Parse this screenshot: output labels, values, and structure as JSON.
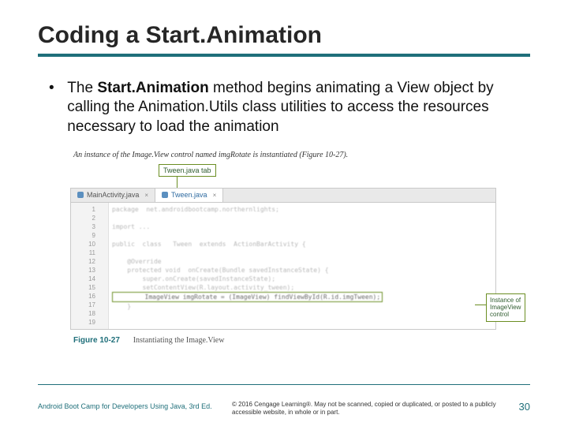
{
  "title": "Coding a Start.Animation",
  "bullet": {
    "prefix": "The ",
    "strong": "Start.Animation",
    "rest": " method begins animating a View object by calling the Animation.Utils class utilities to access the resources necessary to load the animation"
  },
  "figure": {
    "top_caption": "An instance of the Image.View control named imgRotate is instantiated (Figure 10-27).",
    "callout_top": "Tween.java tab",
    "tabs": {
      "inactive": "MainActivity.java",
      "active": "Tween.java"
    },
    "callout_right_l1": "Instance of",
    "callout_right_l2": "ImageView",
    "callout_right_l3": "control",
    "label_num": "Figure 10-27",
    "label_desc": "Instantiating the Image.View",
    "code_lines": [
      "package  net.androidbootcamp.northernlights;",
      "",
      "import ...",
      "",
      "public  class   Tween  extends  ActionBarActivity {",
      "",
      "    @Override",
      "    protected void  onCreate(Bundle savedInstanceState) {",
      "        super.onCreate(savedInstanceState);",
      "        setContentView(R.layout.activity_tween);",
      "        ImageView imgRotate = (ImageView) findViewById(R.id.imgTween);",
      "    }",
      ""
    ],
    "line_numbers": [
      "1",
      "2",
      "3",
      "",
      "9",
      "10",
      "11",
      "12",
      "13",
      "14",
      "15",
      "16",
      "17",
      "18",
      "19"
    ]
  },
  "footer": {
    "book": "Android Boot Camp for Developers Using Java, 3rd Ed.",
    "copyright": "© 2016 Cengage Learning®. May not be scanned, copied or duplicated, or posted to a publicly accessible website, in whole or in part.",
    "page": "30"
  }
}
